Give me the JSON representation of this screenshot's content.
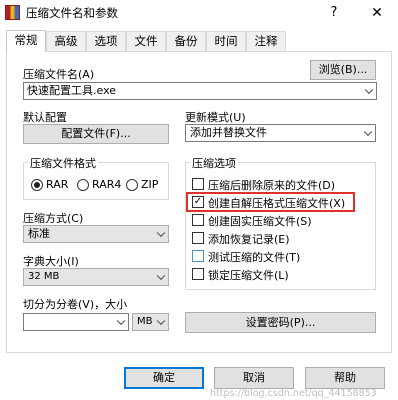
{
  "window": {
    "title": "压缩文件名和参数",
    "help_glyph": "?",
    "close_glyph": "✕"
  },
  "tabs": [
    {
      "label": "常规",
      "active": true
    },
    {
      "label": "高级"
    },
    {
      "label": "选项"
    },
    {
      "label": "文件"
    },
    {
      "label": "备份"
    },
    {
      "label": "时间"
    },
    {
      "label": "注释"
    }
  ],
  "archive_name": {
    "label": "压缩文件名(A)",
    "value": "快速配置工具.exe",
    "browse_label": "浏览(B)..."
  },
  "default_profile": {
    "label": "默认配置",
    "button_label": "配置文件(F)..."
  },
  "update_mode": {
    "label": "更新模式(U)",
    "value": "添加并替换文件"
  },
  "archive_format": {
    "label": "压缩文件格式",
    "options": [
      {
        "label": "RAR",
        "selected": true
      },
      {
        "label": "RAR4",
        "selected": false
      },
      {
        "label": "ZIP",
        "selected": false
      }
    ]
  },
  "compression_method": {
    "label": "压缩方式(C)",
    "value": "标准"
  },
  "dictionary_size": {
    "label": "字典大小(I)",
    "value": "32 MB"
  },
  "split_volumes": {
    "label": "切分为分卷(V)，大小",
    "value": "",
    "unit": "MB"
  },
  "archiving_options": {
    "label": "压缩选项",
    "items": [
      {
        "label": "压缩后删除原来的文件(D)",
        "checked": false
      },
      {
        "label": "创建自解压格式压缩文件(X)",
        "checked": true,
        "highlighted": true
      },
      {
        "label": "创建固实压缩文件(S)",
        "checked": false
      },
      {
        "label": "添加恢复记录(E)",
        "checked": false
      },
      {
        "label": "测试压缩的文件(T)",
        "checked": false
      },
      {
        "label": "锁定压缩文件(L)",
        "checked": false
      }
    ]
  },
  "password_button": "设置密码(P)...",
  "footer": {
    "ok": "确定",
    "cancel": "取消",
    "help": "帮助",
    "watermark": "https://blog.csdn.net/qq_44158853"
  },
  "colors": {
    "accent": "#0078d7",
    "highlight": "#e0302a"
  }
}
